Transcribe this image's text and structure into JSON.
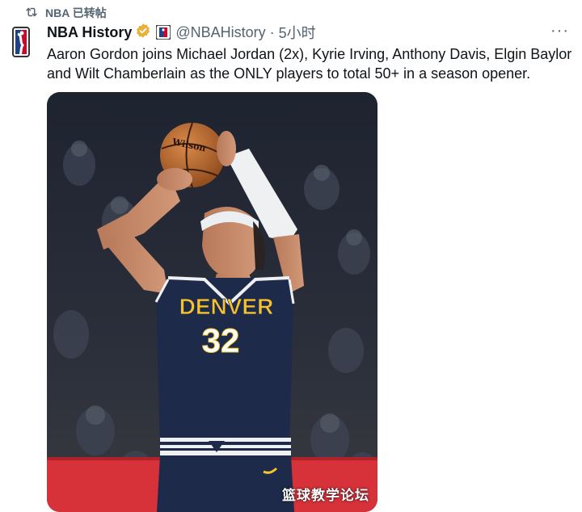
{
  "repost": {
    "label": "NBA 已转帖"
  },
  "tweet": {
    "author_name": "NBA History",
    "handle": "@NBAHistory",
    "separator": "·",
    "time": "5小时",
    "more_label": "···",
    "text": "Aaron Gordon joins Michael Jordan (2x), Kyrie Irving, Anthony Davis, Elgin Baylor and Wilt Chamberlain as the ONLY players to total 50+ in a season opener."
  },
  "media": {
    "jersey_team": "DENVER",
    "jersey_number": "32",
    "ball_brand": "Wilson"
  },
  "watermark": {
    "text": "篮球教学论坛"
  },
  "colors": {
    "text_primary": "#0f1419",
    "text_secondary": "#536471",
    "verified_gold": "#e8b23a",
    "jersey_navy": "#1d2a4a",
    "jersey_gold": "#f6c32c"
  },
  "icons": {
    "repost": "repost-icon",
    "verified": "verified-gold-icon",
    "more": "more-icon",
    "avatar": "nba-logo-icon"
  }
}
